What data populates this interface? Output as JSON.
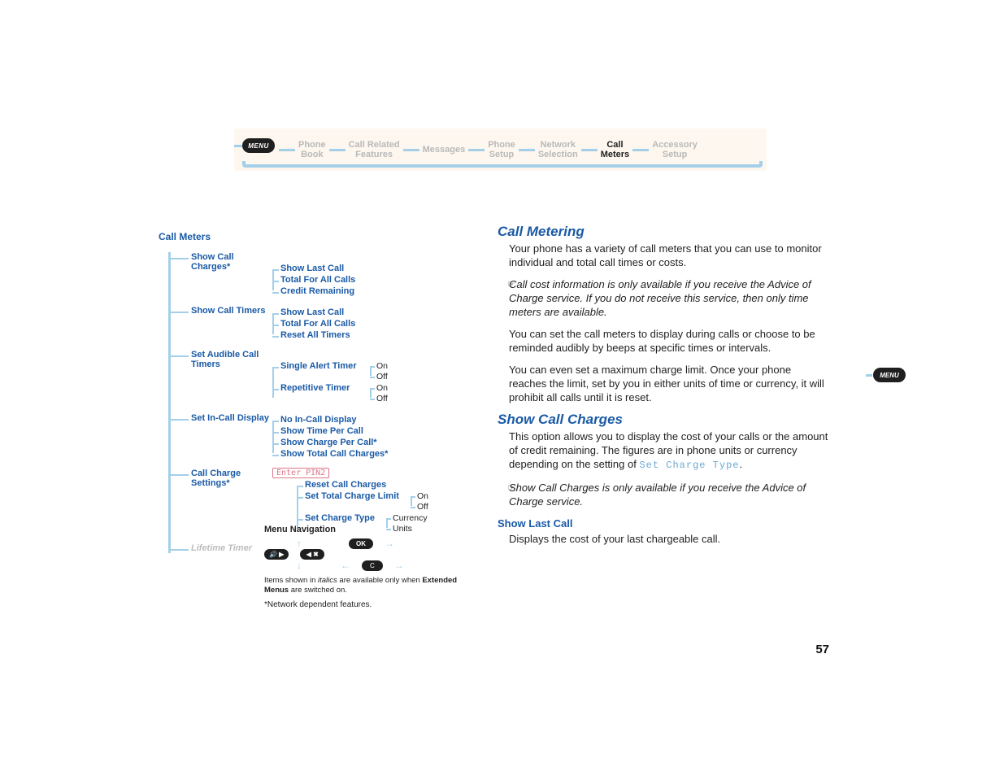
{
  "breadcrumb": {
    "menu": "MENU",
    "items": [
      {
        "l1": "Phone",
        "l2": "Book",
        "active": false
      },
      {
        "l1": "Call Related",
        "l2": "Features",
        "active": false
      },
      {
        "l1": "Messages",
        "l2": "",
        "active": false
      },
      {
        "l1": "Phone",
        "l2": "Setup",
        "active": false
      },
      {
        "l1": "Network",
        "l2": "Selection",
        "active": false
      },
      {
        "l1": "Call",
        "l2": "Meters",
        "active": true
      },
      {
        "l1": "Accessory",
        "l2": "Setup",
        "active": false
      }
    ]
  },
  "side_menu_label": "MENU",
  "diagram": {
    "title": "Call Meters",
    "nodes": [
      {
        "label": "Show Call Charges*",
        "children": [
          "Show Last Call",
          "Total For All Calls",
          "Credit Remaining"
        ]
      },
      {
        "label": "Show Call Timers",
        "children": [
          "Show Last Call",
          "Total For All Calls",
          "Reset All Timers"
        ]
      },
      {
        "label": "Set Audible Call Timers",
        "children": [
          {
            "label": "Single Alert Timer",
            "children": [
              "On",
              "Off"
            ]
          },
          {
            "label": "Repetitive Timer",
            "children": [
              "On",
              "Off"
            ]
          }
        ]
      },
      {
        "label": "Set In-Call Display",
        "children": [
          "No In-Call Display",
          "Show Time Per Call",
          "Show Charge Per Call*",
          "Show Total Call Charges*"
        ]
      },
      {
        "label": "Call Charge Settings*",
        "pin": "Enter PIN2",
        "children": [
          {
            "label": "Reset Call Charges"
          },
          {
            "label": "Set Total Charge Limit",
            "children": [
              "On",
              "Off"
            ]
          },
          {
            "label": "Set Charge Type",
            "children": [
              "Currency",
              "Units"
            ]
          }
        ]
      },
      {
        "label": "Lifetime Timer",
        "faded": true
      }
    ],
    "nav": {
      "title": "Menu Navigation",
      "ok": "OK",
      "c": "C",
      "vol": "🔊 ▶",
      "lr": "◀ ✖",
      "note_pre": "Items shown in ",
      "note_em": "italics",
      "note_mid": " are available only when ",
      "note_bold": "Extended Menus",
      "note_post": " are switched on.",
      "foot": "*Network dependent features."
    }
  },
  "content": {
    "h_metering": "Call Metering",
    "p1": "Your phone has a variety of call meters that you can use to monitor individual and total call times or costs.",
    "n1": "Call cost information is only available if you receive the Advice of Charge service. If you do not receive this service, then only time meters are available.",
    "p2": "You can set the call meters to display during calls or choose to be reminded audibly by beeps at specific times or intervals.",
    "p3": "You can even set a maximum charge limit. Once your phone reaches the limit, set by you in either units of time or currency, it will prohibit all calls until it is reset.",
    "h_charges": "Show Call Charges",
    "p4a": "This option allows you to display the cost of your calls or the amount of credit remaining. The figures are in phone units or currency depending on the setting of ",
    "p4m": "Set Charge Type",
    "p4b": ".",
    "n2": "Show Call Charges is only available if you receive the Advice of Charge service.",
    "h_last": "Show Last Call",
    "p5": "Displays the cost of your last chargeable call."
  },
  "page_number": "57"
}
